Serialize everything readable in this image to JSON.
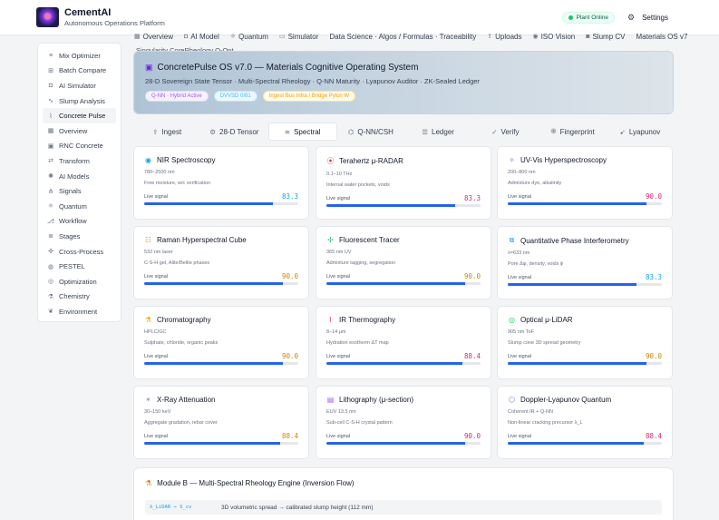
{
  "app": {
    "title": "CementAI",
    "subtitle": "Autonomous Operations Platform"
  },
  "header": {
    "status": "Plant Online",
    "settings_label": "Settings"
  },
  "topnav": [
    {
      "label": "Overview",
      "icon": "grid-icon"
    },
    {
      "label": "AI Model",
      "icon": "bot-icon"
    },
    {
      "label": "Quantum",
      "icon": "atom-icon"
    },
    {
      "label": "Simulator",
      "icon": "monitor-icon"
    },
    {
      "label": "Data Science · Algos / Formulas · Traceability",
      "icon": ""
    },
    {
      "label": "Uploads",
      "icon": "upload-icon"
    },
    {
      "label": "ISO Vision",
      "icon": "eye-icon"
    },
    {
      "label": "Slump CV",
      "icon": "camera-icon"
    },
    {
      "label": "Materials OS v7",
      "icon": ""
    }
  ],
  "subcaption": "Singularity CoreRheology Q-Opt",
  "sidebar": [
    {
      "label": "Mix Optimizer",
      "icon": "sliders-icon"
    },
    {
      "label": "Batch Compare",
      "icon": "compare-icon"
    },
    {
      "label": "AI Simulator",
      "icon": "bot-icon"
    },
    {
      "label": "Slump Analysis",
      "icon": "wave-icon"
    },
    {
      "label": "Concrete Pulse",
      "icon": "pulse-icon",
      "active": true
    },
    {
      "label": "Overview",
      "icon": "grid-icon"
    },
    {
      "label": "RNC Concrete",
      "icon": "cube-icon"
    },
    {
      "label": "Transform",
      "icon": "transform-icon"
    },
    {
      "label": "AI Models",
      "icon": "brain-icon"
    },
    {
      "label": "Signals",
      "icon": "signal-icon"
    },
    {
      "label": "Quantum",
      "icon": "atom-icon"
    },
    {
      "label": "Workflow",
      "icon": "workflow-icon"
    },
    {
      "label": "Stages",
      "icon": "stages-icon"
    },
    {
      "label": "Cross-Process",
      "icon": "cross-icon"
    },
    {
      "label": "PESTEL",
      "icon": "globe-icon"
    },
    {
      "label": "Optimization",
      "icon": "target-icon"
    },
    {
      "label": "Chemistry",
      "icon": "flask-icon"
    },
    {
      "label": "Environment",
      "icon": "leaf-icon"
    }
  ],
  "hero": {
    "title": "ConcretePulse OS v7.0 — Materials Cognitive Operating System",
    "subtitle": "28-D Sovereign State Tensor · Multi-Spectral Rheology · Q-NN Maturity · Lyapunov Auditor · ZK-Sealed Ledger",
    "chips": [
      "Q-NN · Hybrid Active",
      "DVVSD 0/81",
      "Ingest Bus Infra / Bridge Pylon W"
    ]
  },
  "tabs": [
    {
      "label": "Ingest",
      "icon": "upload-icon"
    },
    {
      "label": "28-D Tensor",
      "icon": "gear-icon"
    },
    {
      "label": "Spectral",
      "icon": "waves-icon",
      "active": true
    },
    {
      "label": "Q-NN/CSH",
      "icon": "network-icon"
    },
    {
      "label": "Ledger",
      "icon": "ledger-icon"
    },
    {
      "label": "Verify",
      "icon": "check-icon"
    },
    {
      "label": "Fingerprint",
      "icon": "fingerprint-icon"
    },
    {
      "label": "Lyapunov",
      "icon": "cursor-icon"
    }
  ],
  "live_label": "Live signal",
  "cards": [
    {
      "title": "NIR Spectroscopy",
      "spec": "780–2500 nm",
      "desc": "Free moisture, w/c verification",
      "value": "83.3",
      "tone": "blue",
      "icon": "eye-icon",
      "icon_color": "#0ea5e9"
    },
    {
      "title": "Terahertz μ-RADAR",
      "spec": "0.1–10 THz",
      "desc": "Internal water pockets, voids",
      "value": "83.3",
      "tone": "pink",
      "icon": "radar-icon",
      "icon_color": "#e11d48"
    },
    {
      "title": "UV-Vis Hyperspectroscopy",
      "spec": "200–800 nm",
      "desc": "Admixture dye, alkalinity",
      "value": "90.0",
      "tone": "pink",
      "icon": "sparkle-icon",
      "icon_color": "#a855f7"
    },
    {
      "title": "Raman Hyperspectral Cube",
      "spec": "532 nm laser",
      "desc": "C-S-H gel, Alite/Belite phases",
      "value": "90.0",
      "tone": "yellow",
      "icon": "layers-icon",
      "icon_color": "#f59e0b"
    },
    {
      "title": "Fluorescent Tracer",
      "spec": "365 nm UV",
      "desc": "Admixture tagging, segregation",
      "value": "90.0",
      "tone": "yellow",
      "icon": "plus-sparkle-icon",
      "icon_color": "#22c55e"
    },
    {
      "title": "Quantitative Phase Interferometry",
      "spec": "λ=633 nm",
      "desc": "Pore Δφ, density, voids ϕ",
      "value": "83.3",
      "tone": "blue",
      "icon": "stack-icon",
      "icon_color": "#0ea5e9"
    },
    {
      "title": "Chromatography",
      "spec": "HPLC/GC",
      "desc": "Sulphate, chloride, organic peaks",
      "value": "90.0",
      "tone": "yellow",
      "icon": "flask-icon",
      "icon_color": "#f59e0b"
    },
    {
      "title": "IR Thermography",
      "spec": "8–14 μm",
      "desc": "Hydration exotherm ΔT map",
      "value": "88.4",
      "tone": "pink",
      "icon": "pulse-icon",
      "icon_color": "#e11d48"
    },
    {
      "title": "Optical μ-LiDAR",
      "spec": "905 nm ToF",
      "desc": "Slump cone 3D spread geometry",
      "value": "90.0",
      "tone": "yellow",
      "icon": "target-icon",
      "icon_color": "#22c55e"
    },
    {
      "title": "X-Ray Attenuation",
      "spec": "30–150 keV",
      "desc": "Aggregate gradation, rebar cover",
      "value": "88.4",
      "tone": "yellow",
      "icon": "xray-icon",
      "icon_color": "#9ca3af"
    },
    {
      "title": "Lithography (μ-section)",
      "spec": "EUV 13.5 nm",
      "desc": "Sub-cell C-S-H crystal pattern",
      "value": "90.0",
      "tone": "pink",
      "icon": "chip-icon",
      "icon_color": "#a855f7"
    },
    {
      "title": "Doppler-Lyapunov Quantum",
      "spec": "Coherent IR + Q-NN",
      "desc": "Non-linear cracking precursor λ_L",
      "value": "88.4",
      "tone": "pink",
      "icon": "quantum-icon",
      "icon_color": "#6366f1"
    }
  ],
  "module_b": {
    "title": "Module B — Multi-Spectral Rheology Engine (Inversion Flow)",
    "code": "λ_LiDAR → S_cv",
    "desc": "3D volumetric spread → calibrated slump height (112 mm)"
  }
}
